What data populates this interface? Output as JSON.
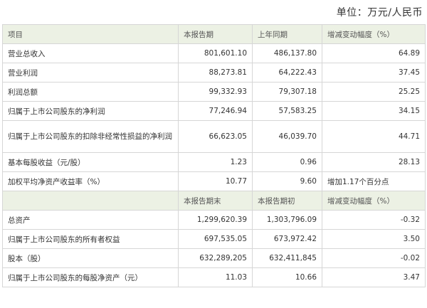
{
  "unit_label": "单位：万元/人民币",
  "header1": [
    "项目",
    "本报告期",
    "上年同期",
    "增减变动幅度（%）"
  ],
  "rows1": [
    [
      "营业总收入",
      "801,601.10",
      "486,137.80",
      "64.89"
    ],
    [
      "营业利润",
      "88,273.81",
      "64,222.43",
      "37.45"
    ],
    [
      "利润总额",
      "99,332.93",
      "79,307.18",
      "25.25"
    ],
    [
      "归属于上市公司股东的净利润",
      "77,246.94",
      "57,583.25",
      "34.15"
    ],
    [
      "归属于上市公司股东的扣除非经常性损益的净利润",
      "66,623.05",
      "46,039.70",
      "44.71"
    ],
    [
      "基本每股收益（元/股）",
      "1.23",
      "0.96",
      "28.13"
    ],
    [
      "加权平均净资产收益率（%）",
      "10.77",
      "9.60",
      "增加1.17个百分点"
    ]
  ],
  "header2": [
    "",
    "本报告期末",
    "本报告期初",
    "增减变动幅度（%）"
  ],
  "rows2": [
    [
      "总资产",
      "1,299,620.39",
      "1,303,796.09",
      "-0.32"
    ],
    [
      "归属于上市公司股东的所有者权益",
      "697,535.05",
      "673,972.42",
      "3.50"
    ],
    [
      "股本（股）",
      "632,289,205",
      "632,411,845",
      "-0.02"
    ],
    [
      "归属于上市公司股东的每股净资产（元）",
      "11.03",
      "10.66",
      "3.47"
    ]
  ]
}
